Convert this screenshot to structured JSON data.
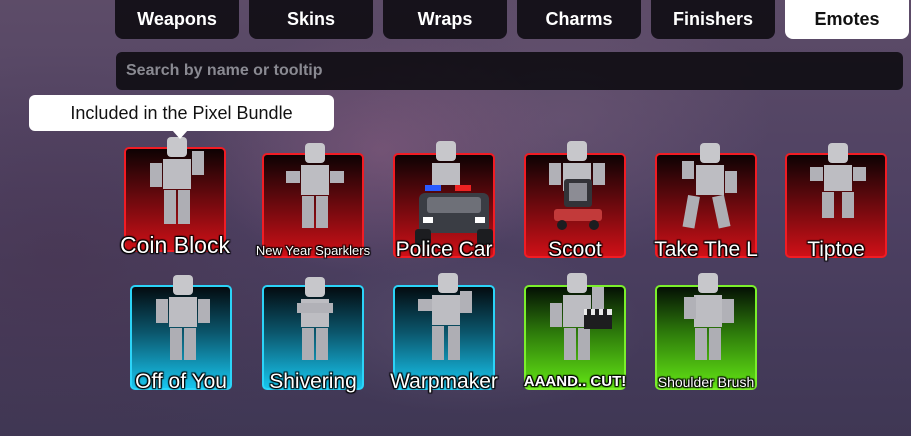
{
  "tabs": [
    {
      "label": "Weapons",
      "active": false
    },
    {
      "label": "Skins",
      "active": false
    },
    {
      "label": "Wraps",
      "active": false
    },
    {
      "label": "Charms",
      "active": false
    },
    {
      "label": "Finishers",
      "active": false
    },
    {
      "label": "Emotes",
      "active": true
    }
  ],
  "search": {
    "placeholder": "Search by name or tooltip"
  },
  "tooltip": {
    "text": "Included in the Pixel Bundle"
  },
  "emotes": [
    {
      "name": "Coin Block",
      "rarity": "red"
    },
    {
      "name": "New Year Sparklers",
      "rarity": "red"
    },
    {
      "name": "Police Car",
      "rarity": "red"
    },
    {
      "name": "Scoot",
      "rarity": "red"
    },
    {
      "name": "Take The L",
      "rarity": "red"
    },
    {
      "name": "Tiptoe",
      "rarity": "red"
    },
    {
      "name": "Off of You",
      "rarity": "blue"
    },
    {
      "name": "Shivering",
      "rarity": "blue"
    },
    {
      "name": "Warpmaker",
      "rarity": "blue"
    },
    {
      "name": "AAAND.. CUT!",
      "rarity": "green"
    },
    {
      "name": "Shoulder Brush",
      "rarity": "green"
    }
  ],
  "colors": {
    "red": "#f11c24",
    "blue": "#2bd4f8",
    "green": "#7bf02b"
  }
}
